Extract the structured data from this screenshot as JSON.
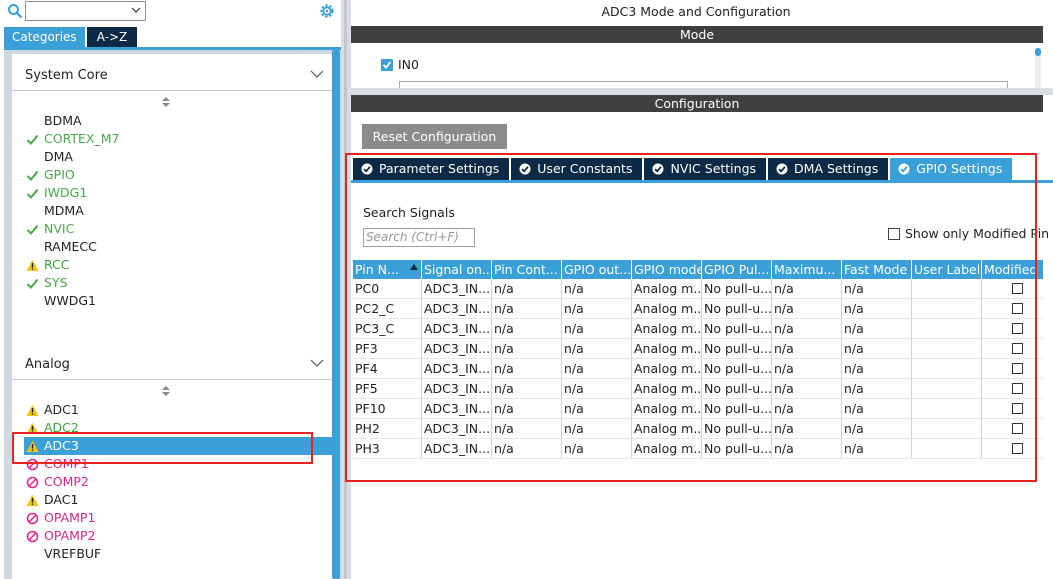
{
  "left": {
    "search": {
      "value": ""
    },
    "tabs": [
      {
        "label": "Categories",
        "active": true
      },
      {
        "label": "A->Z",
        "active": false
      }
    ],
    "groups": [
      {
        "title": "System Core",
        "items": [
          {
            "label": "BDMA",
            "status": "none"
          },
          {
            "label": "CORTEX_M7",
            "status": "ok"
          },
          {
            "label": "DMA",
            "status": "none"
          },
          {
            "label": "GPIO",
            "status": "ok"
          },
          {
            "label": "IWDG1",
            "status": "ok"
          },
          {
            "label": "MDMA",
            "status": "none"
          },
          {
            "label": "NVIC",
            "status": "ok"
          },
          {
            "label": "RAMECC",
            "status": "none"
          },
          {
            "label": "RCC",
            "status": "warning"
          },
          {
            "label": "SYS",
            "status": "ok"
          },
          {
            "label": "WWDG1",
            "status": "none"
          }
        ]
      },
      {
        "title": "Analog",
        "items": [
          {
            "label": "ADC1",
            "status": "warning"
          },
          {
            "label": "ADC2",
            "status": "warning"
          },
          {
            "label": "ADC3",
            "status": "warning",
            "selected": true
          },
          {
            "label": "COMP1",
            "status": "disabled"
          },
          {
            "label": "COMP2",
            "status": "disabled"
          },
          {
            "label": "DAC1",
            "status": "warning"
          },
          {
            "label": "OPAMP1",
            "status": "disabled"
          },
          {
            "label": "OPAMP2",
            "status": "disabled"
          },
          {
            "label": "VREFBUF",
            "status": "none"
          }
        ]
      }
    ]
  },
  "right": {
    "title": "ADC3 Mode and Configuration",
    "mode_header": "Mode",
    "mode_in0_label": "IN0",
    "mode_in0_checked": true,
    "config_header": "Configuration",
    "reset_button": "Reset Configuration",
    "tabs": [
      {
        "label": "Parameter Settings",
        "active": false
      },
      {
        "label": "User Constants",
        "active": false
      },
      {
        "label": "NVIC Settings",
        "active": false
      },
      {
        "label": "DMA Settings",
        "active": false
      },
      {
        "label": "GPIO Settings",
        "active": true
      }
    ],
    "search_signals_label": "Search Signals",
    "search_signals_placeholder": "Search (Ctrl+F)",
    "show_modified_label": "Show only Modified Pin",
    "show_modified_checked": false,
    "table": {
      "columns": [
        "Pin N...",
        "Signal on...",
        "Pin Cont...",
        "GPIO out...",
        "GPIO mode",
        "GPIO Pul...",
        "Maximu...",
        "Fast Mode",
        "User Label",
        "Modified"
      ],
      "rows": [
        [
          "PC0",
          "ADC3_IN...",
          "n/a",
          "n/a",
          "Analog m...",
          "No pull-u...",
          "n/a",
          "n/a",
          "",
          false
        ],
        [
          "PC2_C",
          "ADC3_IN...",
          "n/a",
          "n/a",
          "Analog m...",
          "No pull-u...",
          "n/a",
          "n/a",
          "",
          false
        ],
        [
          "PC3_C",
          "ADC3_IN...",
          "n/a",
          "n/a",
          "Analog m...",
          "No pull-u...",
          "n/a",
          "n/a",
          "",
          false
        ],
        [
          "PF3",
          "ADC3_IN...",
          "n/a",
          "n/a",
          "Analog m...",
          "No pull-u...",
          "n/a",
          "n/a",
          "",
          false
        ],
        [
          "PF4",
          "ADC3_IN...",
          "n/a",
          "n/a",
          "Analog m...",
          "No pull-u...",
          "n/a",
          "n/a",
          "",
          false
        ],
        [
          "PF5",
          "ADC3_IN...",
          "n/a",
          "n/a",
          "Analog m...",
          "No pull-u...",
          "n/a",
          "n/a",
          "",
          false
        ],
        [
          "PF10",
          "ADC3_IN...",
          "n/a",
          "n/a",
          "Analog m...",
          "No pull-u...",
          "n/a",
          "n/a",
          "",
          false
        ],
        [
          "PH2",
          "ADC3_IN...",
          "n/a",
          "n/a",
          "Analog m...",
          "No pull-u...",
          "n/a",
          "n/a",
          "",
          false
        ],
        [
          "PH3",
          "ADC3_IN...",
          "n/a",
          "n/a",
          "Analog m...",
          "No pull-u...",
          "n/a",
          "n/a",
          "",
          false
        ]
      ]
    }
  },
  "colors": {
    "accent": "#3b9fd8",
    "navy": "#0c2a45",
    "ok": "#4aa74a",
    "warning": "#f0c419",
    "disabled": "#d8268e",
    "highlight": "#e8231f"
  }
}
